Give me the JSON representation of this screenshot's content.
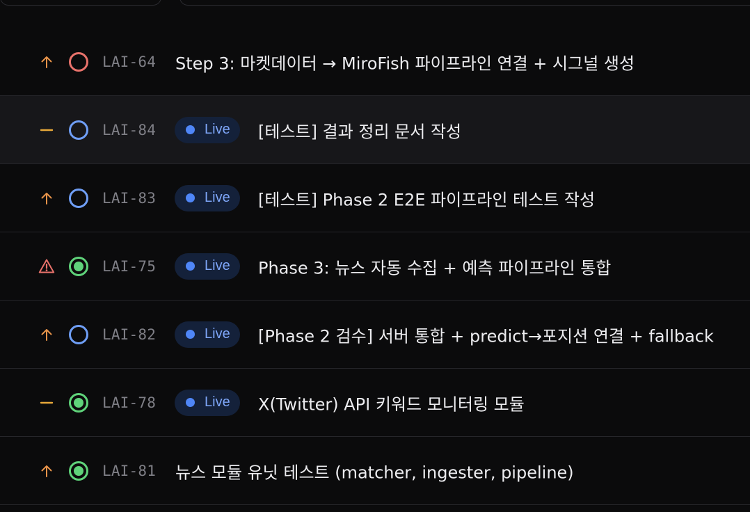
{
  "issues": [
    {
      "priority": "high",
      "priority_icon": "arrow-up-icon",
      "status": "todo",
      "status_color": "#e8726b",
      "id": "LAI-64",
      "live": null,
      "title": "Step 3: 마켓데이터 → MiroFish 파이프라인 연결 + 시그널 생성"
    },
    {
      "priority": "medium",
      "priority_icon": "dash-icon",
      "status": "todo",
      "status_color": "#6f9ef5",
      "id": "LAI-84",
      "live": "Live",
      "title": "[테스트] 결과 정리 문서 작성"
    },
    {
      "priority": "high",
      "priority_icon": "arrow-up-icon",
      "status": "todo",
      "status_color": "#6f9ef5",
      "id": "LAI-83",
      "live": "Live",
      "title": "[테스트] Phase 2 E2E 파이프라인 테스트 작성"
    },
    {
      "priority": "urgent",
      "priority_icon": "warning-icon",
      "status": "in-progress",
      "status_color": "#5fd37a",
      "id": "LAI-75",
      "live": "Live",
      "title": "Phase 3: 뉴스 자동 수집 + 예측 파이프라인 통합"
    },
    {
      "priority": "high",
      "priority_icon": "arrow-up-icon",
      "status": "todo",
      "status_color": "#6f9ef5",
      "id": "LAI-82",
      "live": "Live",
      "title": "[Phase 2 검수] 서버 통합 + predict→포지션 연결 + fallback"
    },
    {
      "priority": "medium",
      "priority_icon": "dash-icon",
      "status": "in-progress",
      "status_color": "#5fd37a",
      "id": "LAI-78",
      "live": "Live",
      "title": "X(Twitter) API 키워드 모니터링 모듈"
    },
    {
      "priority": "high",
      "priority_icon": "arrow-up-icon",
      "status": "in-progress",
      "status_color": "#5fd37a",
      "id": "LAI-81",
      "live": null,
      "title": "뉴스 모듈 유닛 테스트 (matcher, ingester, pipeline)"
    }
  ],
  "colors": {
    "priority_high": "#e8944a",
    "priority_medium": "#e8a93a",
    "priority_urgent": "#e8726b",
    "live_dot": "#4f86f7",
    "live_bg": "#14213a",
    "highlight_row": "#17171a"
  }
}
